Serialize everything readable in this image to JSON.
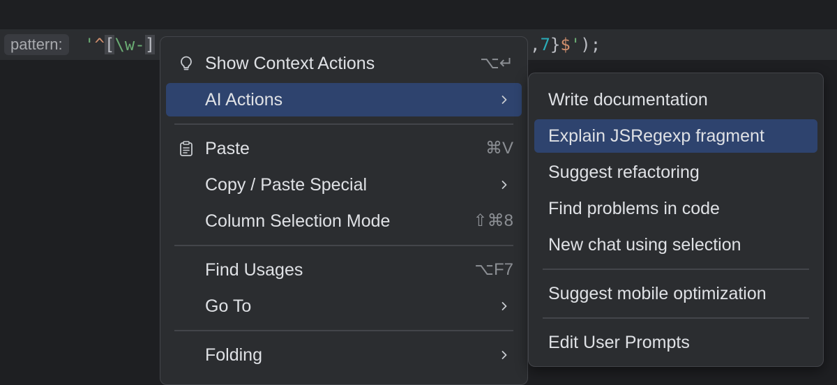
{
  "editor": {
    "param_hint": "pattern:",
    "code_visible_left": [
      "'",
      "^",
      "[",
      "\\w-",
      "]"
    ],
    "code_visible_right": [
      ",",
      "7",
      "}",
      "$",
      "'",
      ");"
    ]
  },
  "context_menu": {
    "items": [
      {
        "label": "Show Context Actions",
        "shortcut": "⌥↵",
        "icon": "lightbulb-icon"
      },
      {
        "label": "AI Actions",
        "has_submenu": true,
        "selected": true
      },
      {
        "label": "Paste",
        "shortcut": "⌘V",
        "icon": "clipboard-icon"
      },
      {
        "label": "Copy / Paste Special",
        "has_submenu": true
      },
      {
        "label": "Column Selection Mode",
        "shortcut": "⇧⌘8"
      },
      {
        "label": "Find Usages",
        "shortcut": "⌥F7"
      },
      {
        "label": "Go To",
        "has_submenu": true
      },
      {
        "label": "Folding",
        "has_submenu": true
      }
    ]
  },
  "ai_submenu": {
    "items": [
      {
        "label": "Write documentation"
      },
      {
        "label": "Explain JSRegexp fragment",
        "selected": true
      },
      {
        "label": "Suggest refactoring"
      },
      {
        "label": "Find problems in code"
      },
      {
        "label": "New chat using selection"
      },
      {
        "label": "Suggest mobile optimization"
      },
      {
        "label": "Edit User Prompts"
      }
    ]
  },
  "colors": {
    "background": "#1e1f22",
    "menu_background": "#2b2d30",
    "selection": "#2e436e",
    "text": "#dfe1e5",
    "shortcut_text": "#8c8f94"
  }
}
